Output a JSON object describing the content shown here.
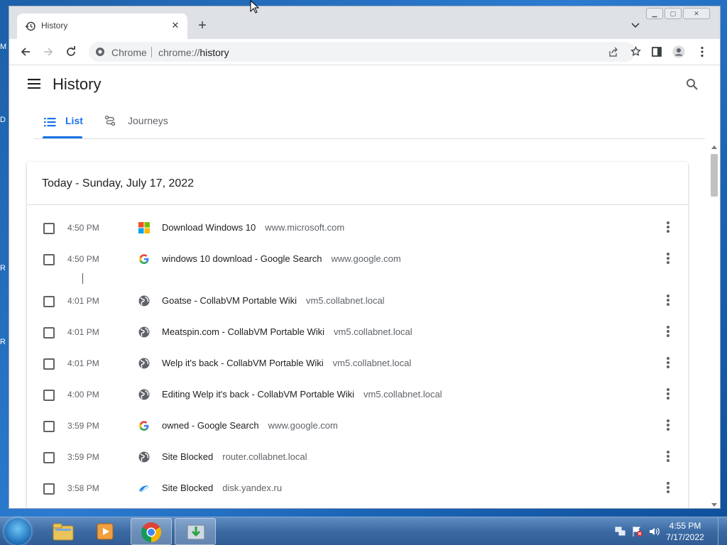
{
  "desktop": {
    "edge_letters": [
      "M",
      "D",
      "R",
      "R"
    ]
  },
  "tab": {
    "title": "History",
    "close_glyph": "✕",
    "new_tab_glyph": "+"
  },
  "window_controls": {
    "minimize_glyph": "▁",
    "maximize_glyph": "▢",
    "close_glyph": "✕"
  },
  "omnibox": {
    "site_label": "Chrome",
    "url_scheme": "chrome://",
    "url_path": "history"
  },
  "page": {
    "title": "History",
    "tabs": [
      {
        "label": "List",
        "active": true
      },
      {
        "label": "Journeys",
        "active": false
      }
    ],
    "date_header": "Today - Sunday, July 17, 2022",
    "entries": [
      {
        "time": "4:50 PM",
        "title": "Download Windows 10",
        "domain": "www.microsoft.com",
        "icon": "microsoft-icon"
      },
      {
        "time": "4:50 PM",
        "title": "windows 10 download - Google Search",
        "domain": "www.google.com",
        "icon": "google-icon"
      },
      {
        "time": "4:01 PM",
        "title": "Goatse - CollabVM Portable Wiki",
        "domain": "vm5.collabnet.local",
        "icon": "globe-icon"
      },
      {
        "time": "4:01 PM",
        "title": "Meatspin.com - CollabVM Portable Wiki",
        "domain": "vm5.collabnet.local",
        "icon": "globe-icon"
      },
      {
        "time": "4:01 PM",
        "title": "Welp it's back - CollabVM Portable Wiki",
        "domain": "vm5.collabnet.local",
        "icon": "globe-icon"
      },
      {
        "time": "4:00 PM",
        "title": "Editing Welp it's back - CollabVM Portable Wiki",
        "domain": "vm5.collabnet.local",
        "icon": "globe-icon"
      },
      {
        "time": "3:59 PM",
        "title": "owned - Google Search",
        "domain": "www.google.com",
        "icon": "google-icon"
      },
      {
        "time": "3:59 PM",
        "title": "Site Blocked",
        "domain": "router.collabnet.local",
        "icon": "globe-icon"
      },
      {
        "time": "3:58 PM",
        "title": "Site Blocked",
        "domain": "disk.yandex.ru",
        "icon": "yandex-disk-icon"
      }
    ]
  },
  "taskbar": {
    "apps": [
      "explorer-icon",
      "media-player-icon",
      "chrome-icon",
      "installer-icon"
    ],
    "clock_time": "4:55 PM",
    "clock_date": "7/17/2022"
  },
  "colors": {
    "accent": "#1a73e8",
    "tabstrip": "#dee1e6"
  }
}
